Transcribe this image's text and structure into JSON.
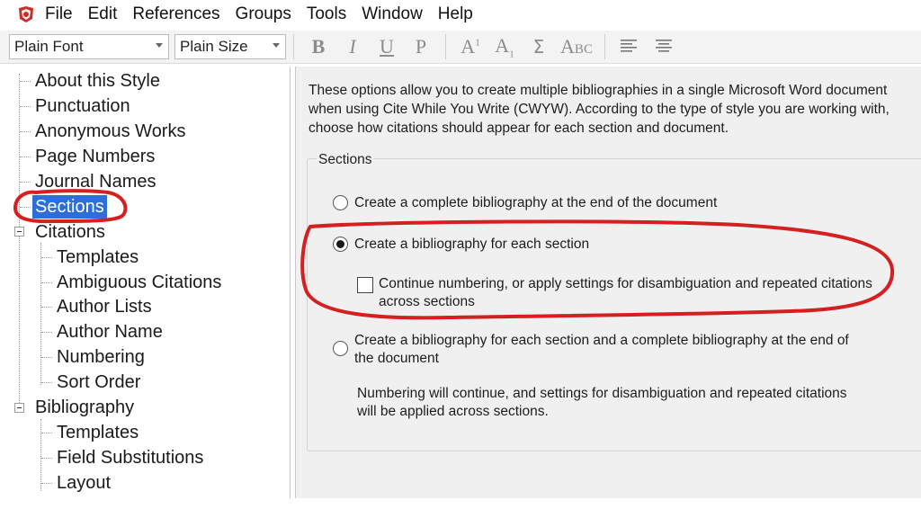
{
  "menu": {
    "items": [
      "File",
      "Edit",
      "References",
      "Groups",
      "Tools",
      "Window",
      "Help"
    ]
  },
  "toolbar": {
    "font_value": "Plain Font",
    "size_value": "Plain Size",
    "bold": "B",
    "italic": "I",
    "underline": "U",
    "plain": "P",
    "superscript": "A",
    "superscript_mark": "1",
    "subscript": "A",
    "subscript_mark": "1",
    "symbol": "Σ",
    "small_caps": "Abc"
  },
  "tree": {
    "items": [
      "About this Style",
      "Punctuation",
      "Anonymous Works",
      "Page Numbers",
      "Journal Names",
      "Sections",
      "Citations",
      "Templates",
      "Ambiguous Citations",
      "Author Lists",
      "Author Name",
      "Numbering",
      "Sort Order",
      "Bibliography",
      "Templates",
      "Field Substitutions",
      "Layout"
    ]
  },
  "panel": {
    "description": "These options allow you to create multiple bibliographies in a single Microsoft Word document when using Cite While You Write (CWYW). According to the type of style you are working with, choose how citations should appear for each section and document.",
    "group_title": "Sections",
    "option1": "Create a complete bibliography at the end of the document",
    "option2": "Create a bibliography for each section",
    "option2_checkbox": "Continue numbering, or apply settings for disambiguation and repeated citations across sections",
    "option3": "Create a bibliography for each section and a complete bibliography at the end of the document",
    "option3_note": "Numbering will continue, and settings for disambiguation and repeated citations will be applied across sections.",
    "selected_option": 2,
    "continue_numbering_checked": false
  },
  "colors": {
    "selection": "#2d6fd6",
    "annotation": "#d42020",
    "panel_bg": "#f0f0f0"
  }
}
